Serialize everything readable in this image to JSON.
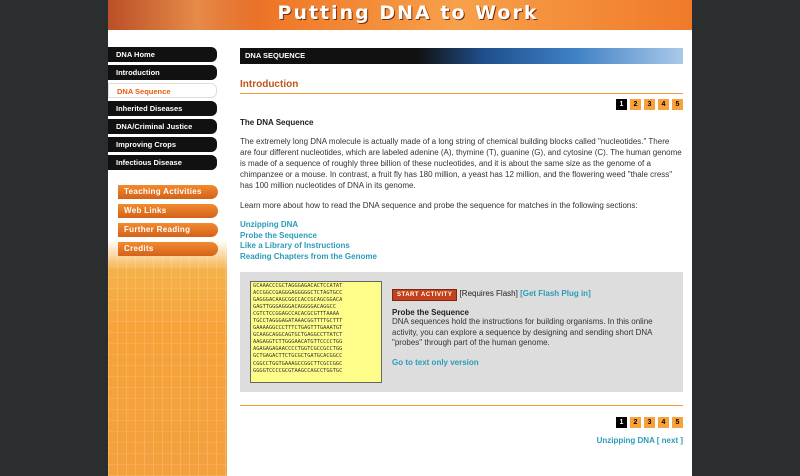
{
  "header": {
    "title": "Putting DNA to Work"
  },
  "nav": {
    "items": [
      {
        "label": "DNA Home",
        "active": false
      },
      {
        "label": "Introduction",
        "active": false
      },
      {
        "label": "DNA Sequence",
        "active": true
      },
      {
        "label": "Inherited Diseases",
        "active": false
      },
      {
        "label": "DNA/Criminal Justice",
        "active": false
      },
      {
        "label": "Improving Crops",
        "active": false
      },
      {
        "label": "Infectious Disease",
        "active": false
      }
    ],
    "sub_items": [
      "Teaching Activities",
      "Web Links",
      "Further Reading",
      "Credits"
    ]
  },
  "section": {
    "label": "DNA SEQUENCE"
  },
  "intro": {
    "title": "Introduction"
  },
  "pager": {
    "pages": [
      "1",
      "2",
      "3",
      "4",
      "5"
    ],
    "current": "1"
  },
  "article": {
    "heading": "The DNA Sequence",
    "paragraph1": "The extremely long DNA molecule is actually made of a long string of chemical building blocks called \"nucleotides.\" There are four different nucleotides, which are labeled adenine (A), thymine (T), guanine (G), and cytosine (C). The human genome is made of a sequence of roughly three billion of these nucleotides, and it is about the same size as the genome of a chimpanzee or a mouse. In contrast, a fruit fly has 180 million, a yeast has 12 million, and the flowering weed \"thale cress\" has 100 million nucleotides of DNA in its genome.",
    "paragraph2": "Learn more about how to read the DNA sequence and probe the sequence for matches in the following sections:",
    "links": [
      "Unzipping DNA",
      "Probe the Sequence",
      "Like a Library of Instructions",
      "Reading Chapters from the Genome"
    ]
  },
  "activity": {
    "sequence": "GCAAACCCGCTAGGGAGACACTCCATAT\nACCGGCCGAGGGAGGGGGCTCTAGTGCC\nGAGGGACAAGCGGCCACCGCAGCGGACA\nGAGTTGGGAGGGACAGGGGACAGGCC\nCGTCTCCGGAGCCACACGCGTTTAAAA\nTGCCTAGGGAGATAAACGGTTTTGCTTT\nGAAAAGGCCCTTTCTGAGTTTGAAATGT\nGCAAGCAGGCAGTGCTGAGGCCTTATCT\nAAGAGGTCTTGGGAACATGTTCCCCTGG\nAGAGAGAGAACCCCTGGTCGCCGCCTGG\nGCTGAGACTTCTGCGCTGATGCACGGCC\nCGGCCTGGTGAAAGCCGGCTTCGCCGGC\nGGGGTCCCCGCGTAAGCCAGCCTGGTGC",
    "start_label": "START ACTIVITY",
    "requires": "[Requires Flash]",
    "flash_link": "[Get Flash Plug in]",
    "probe_title": "Probe the Sequence",
    "probe_text": "DNA sequences hold the instructions for building organisms.  In this online activity, you can explore a sequence by designing and sending short DNA \"probes\" through part of the human genome.",
    "text_only": "Go to text only version"
  },
  "next": {
    "label": "Unzipping DNA [ next ]"
  }
}
